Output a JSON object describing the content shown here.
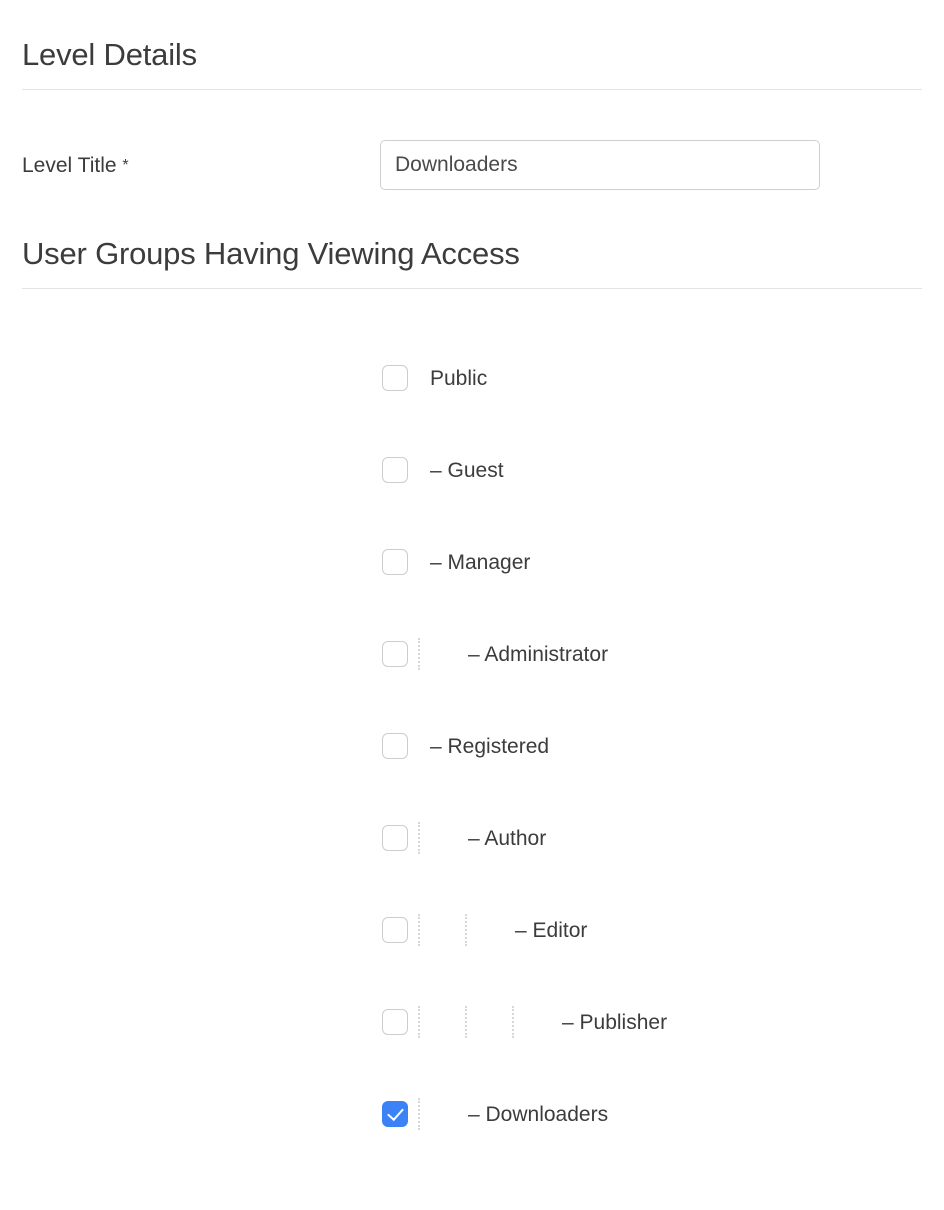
{
  "sections": {
    "level_details": {
      "title": "Level Details"
    },
    "user_groups": {
      "title": "User Groups Having Viewing Access"
    }
  },
  "form": {
    "level_title": {
      "label": "Level Title",
      "required_marker": "*",
      "value": "Downloaders",
      "placeholder": "Level Title"
    }
  },
  "colors": {
    "checkbox_checked": "#3b82f6",
    "checkbox_border": "#cdcdcd",
    "rule": "#e4e4e4",
    "text": "#3c3c3c"
  },
  "groups": [
    {
      "label": "Public",
      "depth": 0,
      "checked": false
    },
    {
      "label": "– Guest",
      "depth": 1,
      "checked": false
    },
    {
      "label": "– Manager",
      "depth": 1,
      "checked": false
    },
    {
      "label": "– Administrator",
      "depth": 2,
      "checked": false
    },
    {
      "label": "– Registered",
      "depth": 1,
      "checked": false
    },
    {
      "label": "– Author",
      "depth": 2,
      "checked": false
    },
    {
      "label": "– Editor",
      "depth": 3,
      "checked": false
    },
    {
      "label": "– Publisher",
      "depth": 4,
      "checked": false
    },
    {
      "label": "– Downloaders",
      "depth": 2,
      "checked": true
    }
  ]
}
